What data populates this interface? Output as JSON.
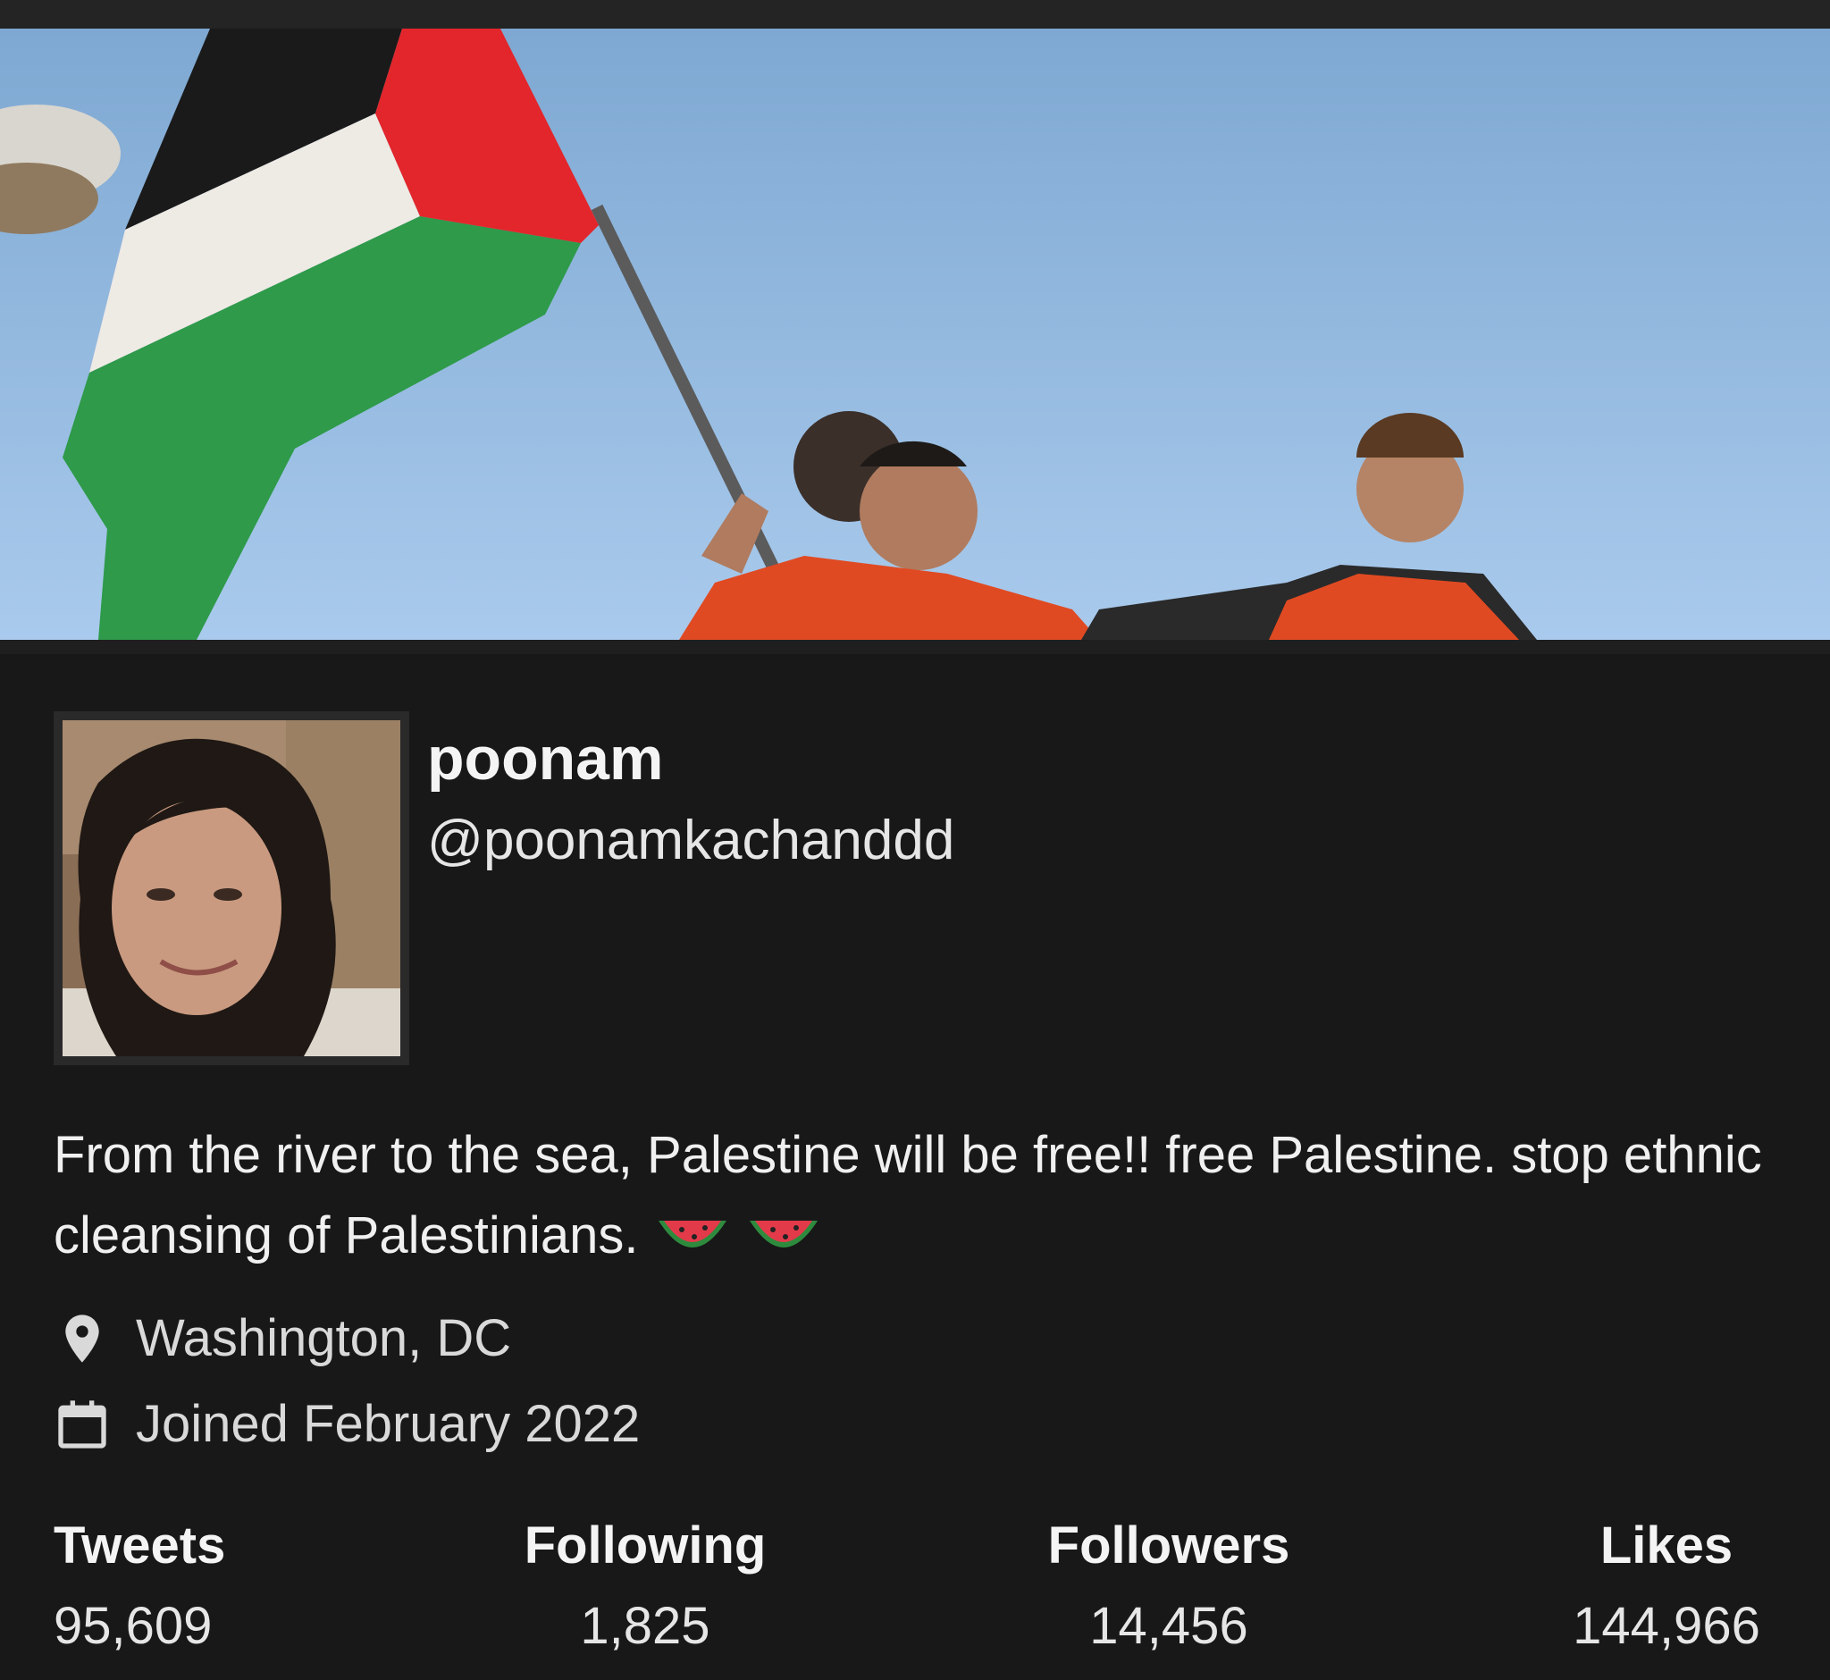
{
  "profile": {
    "display_name": "poonam",
    "handle": "@poonamkachanddd",
    "bio": "From the river to the sea, Palestine will be free!! free Palestine. stop ethnic cleansing of Palestinians.",
    "bio_emoji": [
      "watermelon-emoji",
      "watermelon-emoji"
    ],
    "location": "Washington, DC",
    "joined": "Joined February 2022"
  },
  "stats": [
    {
      "label": "Tweets",
      "value": "95,609"
    },
    {
      "label": "Following",
      "value": "1,825"
    },
    {
      "label": "Followers",
      "value": "14,456"
    },
    {
      "label": "Likes",
      "value": "144,966"
    }
  ],
  "icons": {
    "location": "map-pin-icon",
    "joined": "calendar-icon"
  },
  "colors": {
    "background": "#181818",
    "flag_black": "#1a1a1a",
    "flag_white": "#f0ece8",
    "flag_green": "#2e9a4a",
    "flag_red": "#e2262b"
  }
}
